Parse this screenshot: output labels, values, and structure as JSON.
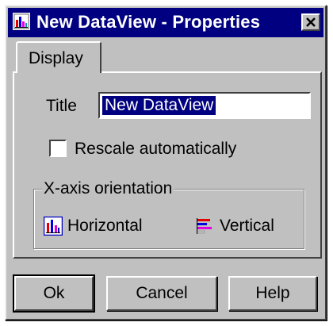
{
  "window": {
    "title": "New DataView - Properties"
  },
  "tabs": [
    {
      "label": "Display",
      "selected": true
    }
  ],
  "display": {
    "title_label": "Title",
    "title_value": "New DataView",
    "rescale_label": "Rescale automatically",
    "rescale_checked": false,
    "orientation_group_label": "X-axis orientation",
    "orientation_options": {
      "horizontal": "Horizontal",
      "vertical": "Vertical"
    }
  },
  "buttons": {
    "ok": "Ok",
    "cancel": "Cancel",
    "help": "Help"
  },
  "colors": {
    "titlebar": "#000080",
    "face": "#c0c0c0"
  },
  "icons": {
    "title": "dataview-icon",
    "close": "close-icon",
    "horizontal": "bar-chart-vertical-bars-icon",
    "vertical": "bar-chart-horizontal-bars-icon"
  }
}
